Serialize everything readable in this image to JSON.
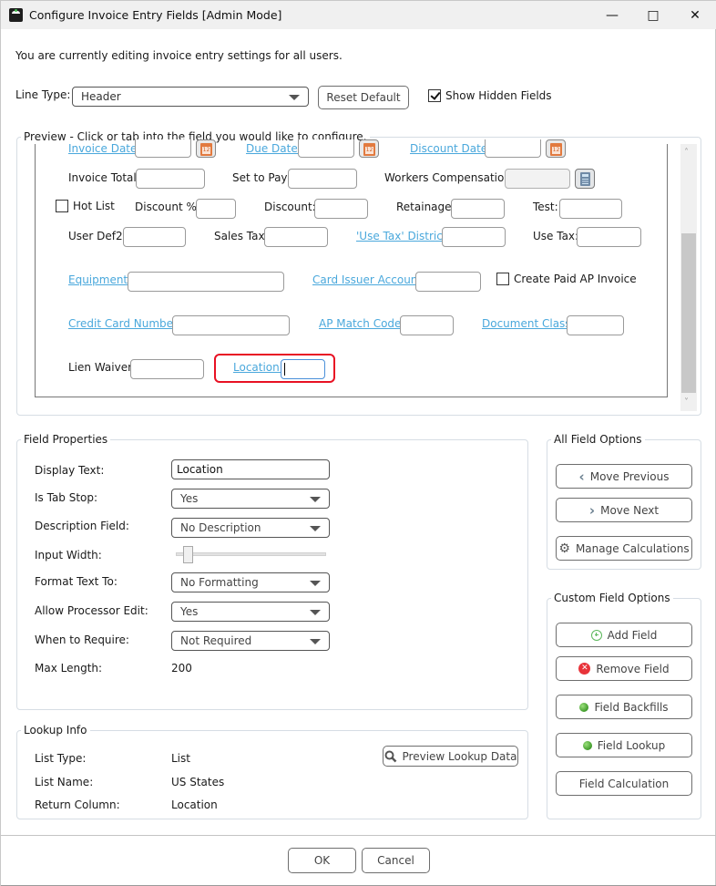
{
  "window": {
    "title": "Configure Invoice Entry Fields [Admin Mode]",
    "controls": {
      "minimize": "—",
      "maximize": "□",
      "close": "✕"
    }
  },
  "header": {
    "info_text": "You are currently editing invoice entry settings for all users.",
    "line_type_label": "Line Type:",
    "line_type_value": "Header",
    "reset_default_label": "Reset Default",
    "show_hidden_fields_label": "Show Hidden Fields",
    "show_hidden_fields_checked": true
  },
  "preview": {
    "title": "Preview - Click or tab into the field you would like to configure.",
    "fields": {
      "invoice_date": "Invoice Date:",
      "due_date": "Due Date:",
      "discount_date": "Discount Date:",
      "invoice_total": "Invoice Total:",
      "set_to_pay": "Set to Pay:",
      "workers_compensation": "Workers Compensation:",
      "hot_list": "Hot List",
      "discount_pct": "Discount %:",
      "discount": "Discount:",
      "retainage": "Retainage:",
      "test": "Test:",
      "user_def2": "User Def2:",
      "sales_tax": "Sales Tax:",
      "use_tax_district": "'Use Tax' District:",
      "use_tax": "Use Tax:",
      "equipment": "Equipment:",
      "card_issuer_account": "Card Issuer Account:",
      "create_paid_ap_invoice": "Create Paid AP Invoice",
      "credit_card_number": "Credit Card Number:",
      "ap_match_code": "AP Match Code:",
      "document_class": "Document Class:",
      "lien_waiver": "Lien Waiver:",
      "location": "Location:"
    },
    "calendar_day": "12",
    "selected_field": "Location",
    "highlight_color": "#e81123"
  },
  "field_properties": {
    "title": "Field Properties",
    "display_text_label": "Display Text:",
    "display_text_value": "Location",
    "is_tab_stop_label": "Is Tab Stop:",
    "is_tab_stop_value": "Yes",
    "description_field_label": "Description Field:",
    "description_field_value": "No Description",
    "input_width_label": "Input Width:",
    "input_width_fraction": 0.05,
    "format_text_label": "Format Text To:",
    "format_text_value": "No Formatting",
    "allow_processor_edit_label": "Allow Processor Edit:",
    "allow_processor_edit_value": "Yes",
    "when_to_require_label": "When to Require:",
    "when_to_require_value": "Not Required",
    "max_length_label": "Max Length:",
    "max_length_value": "200"
  },
  "lookup_info": {
    "title": "Lookup Info",
    "list_type_label": "List Type:",
    "list_type_value": "List",
    "list_name_label": "List Name:",
    "list_name_value": "US States",
    "return_column_label": "Return Column:",
    "return_column_value": "Location",
    "preview_button": "Preview Lookup Data"
  },
  "all_field_options": {
    "title": "All Field Options",
    "move_previous": "Move Previous",
    "move_next": "Move Next",
    "manage_calculations": "Manage Calculations"
  },
  "custom_field_options": {
    "title": "Custom Field Options",
    "add_field": "Add Field",
    "remove_field": "Remove Field",
    "field_backfills": "Field Backfills",
    "field_lookup": "Field Lookup",
    "field_calculation": "Field Calculation"
  },
  "footer": {
    "ok": "OK",
    "cancel": "Cancel"
  }
}
